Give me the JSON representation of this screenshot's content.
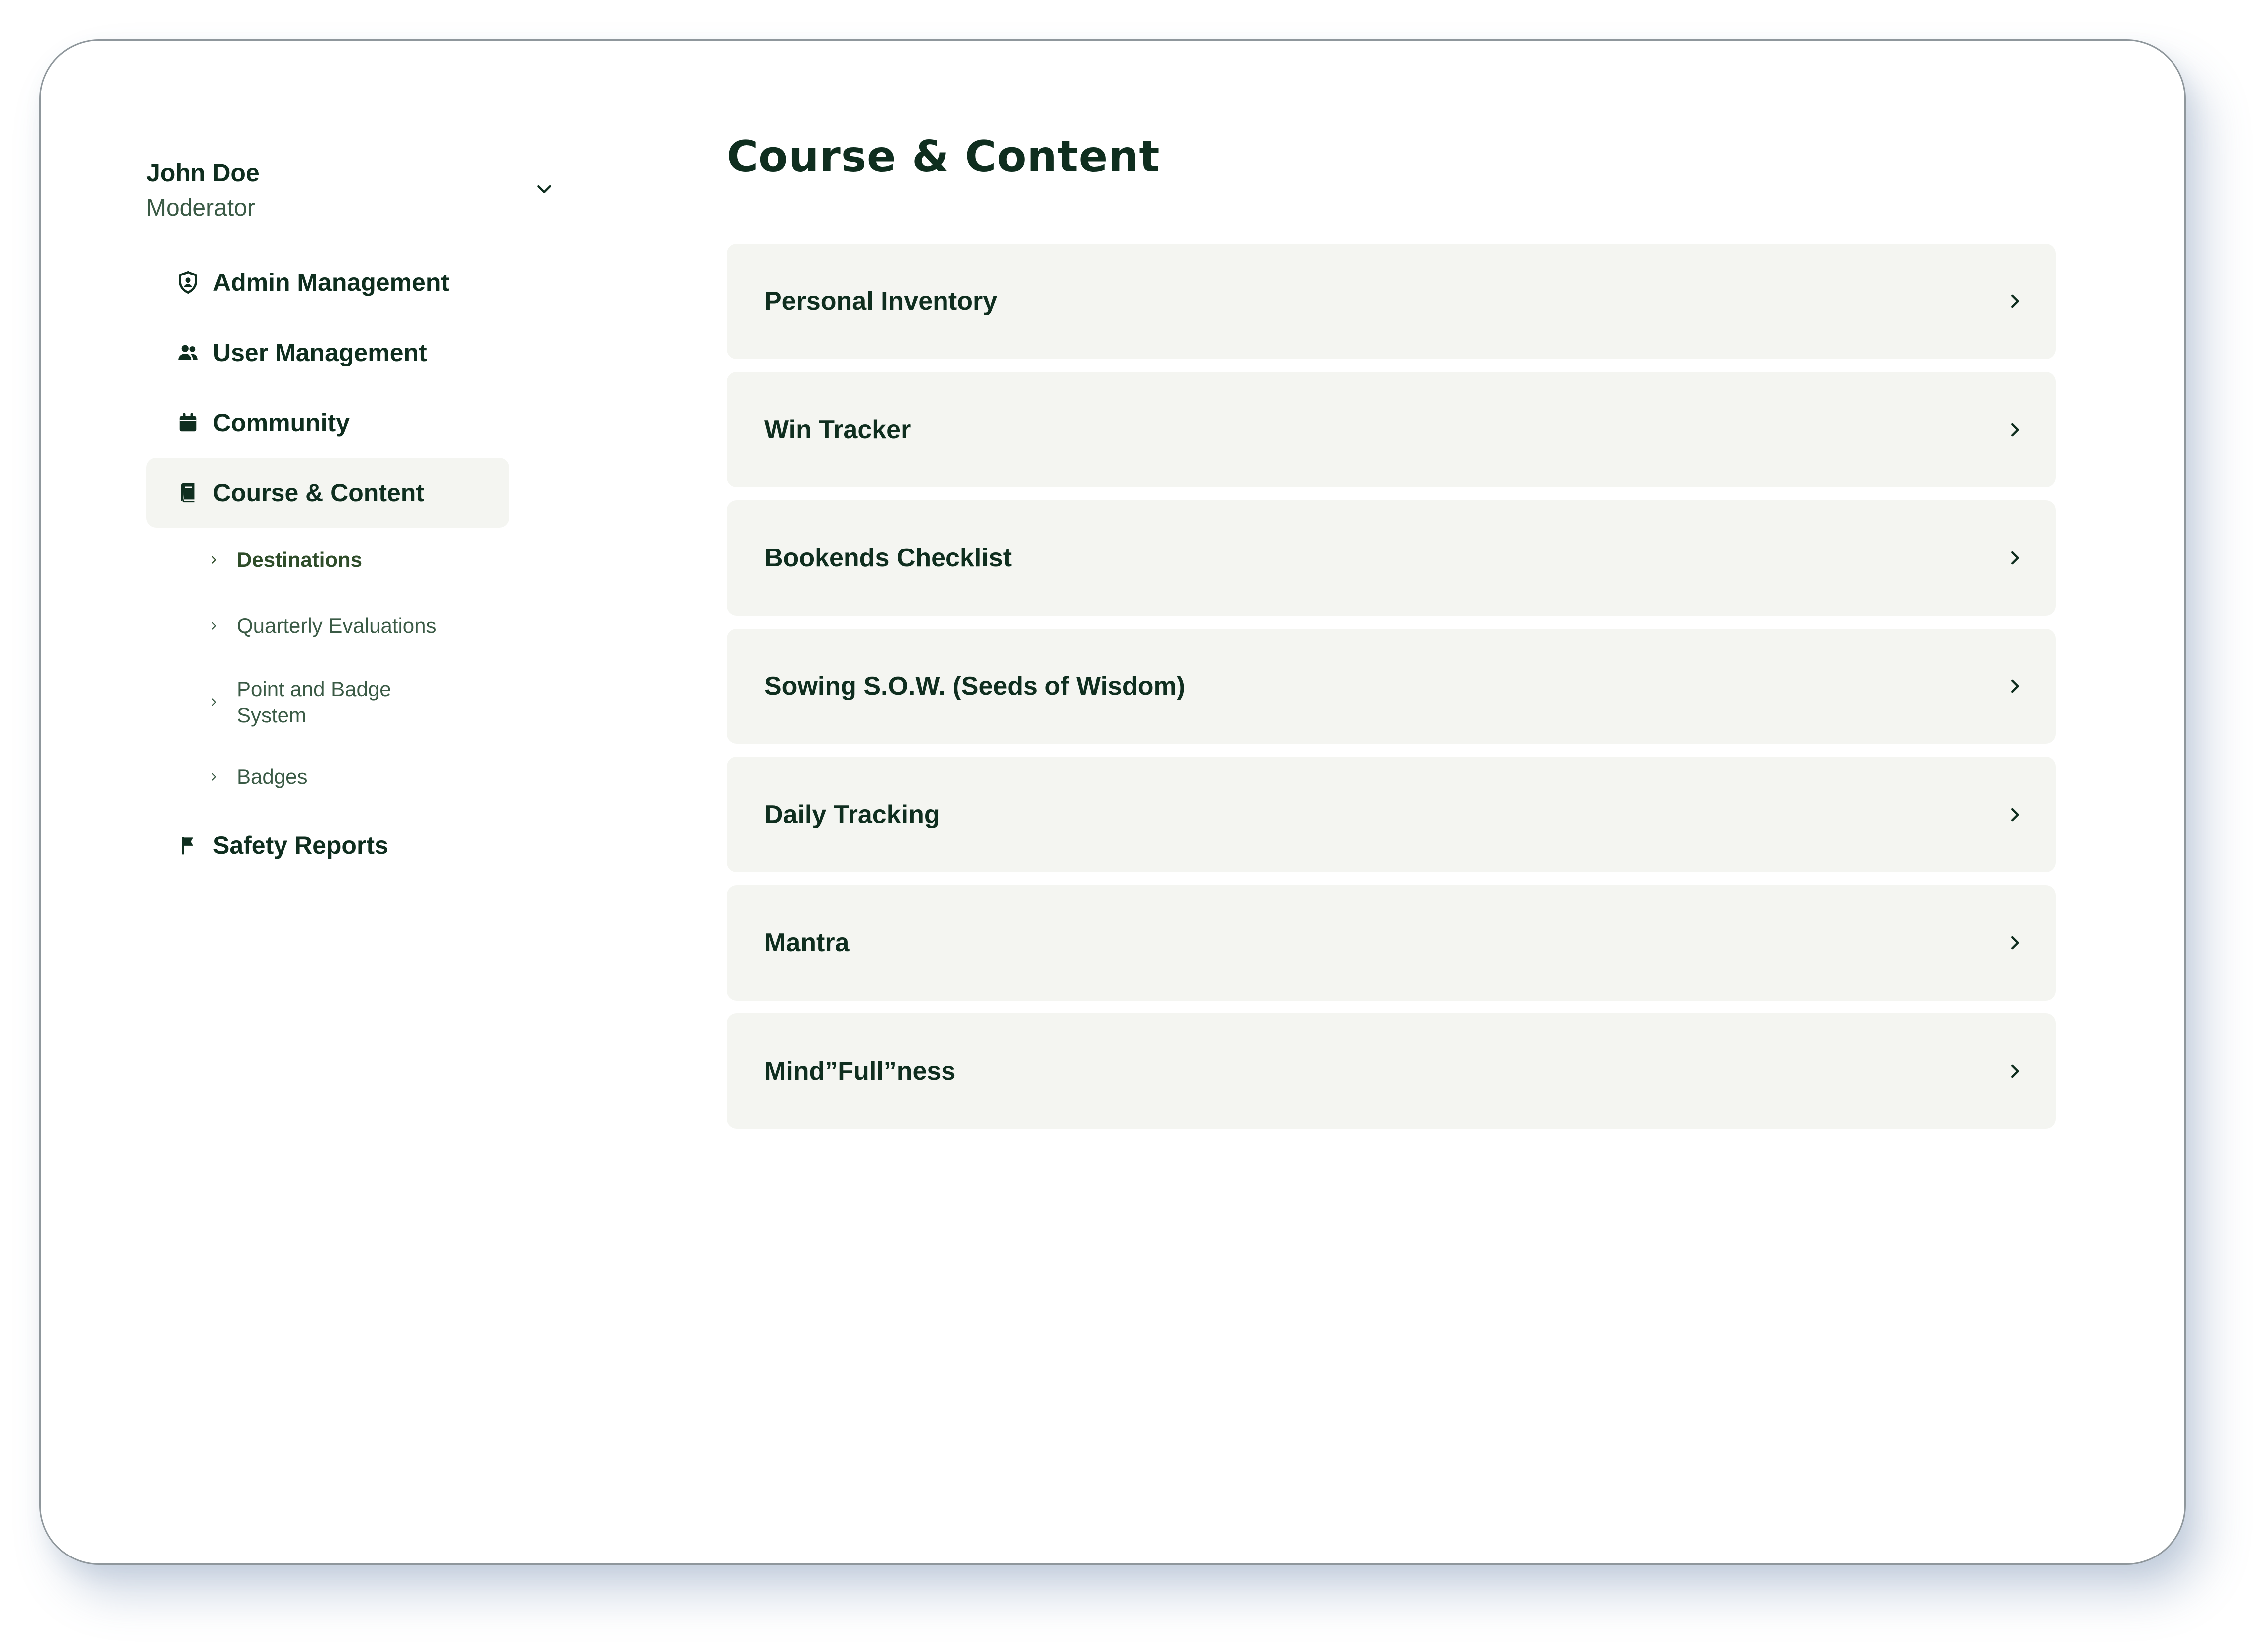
{
  "user": {
    "name": "John Doe",
    "role": "Moderator"
  },
  "sidebar": {
    "items": [
      {
        "label": "Admin Management",
        "icon": "shield-user-icon"
      },
      {
        "label": "User Management",
        "icon": "users-icon"
      },
      {
        "label": "Community",
        "icon": "calendar-icon"
      },
      {
        "label": "Course & Content",
        "icon": "book-icon",
        "active": true
      },
      {
        "label": "Safety Reports",
        "icon": "flag-icon"
      }
    ],
    "course_subitems": [
      {
        "label": "Destinations",
        "active": true
      },
      {
        "label": "Quarterly Evaluations"
      },
      {
        "label": "Point and Badge System"
      },
      {
        "label": "Badges"
      }
    ]
  },
  "main": {
    "title": "Course & Content",
    "cards": [
      {
        "label": "Personal Inventory"
      },
      {
        "label": "Win Tracker"
      },
      {
        "label": "Bookends Checklist"
      },
      {
        "label": "Sowing S.O.W. (Seeds of Wisdom)"
      },
      {
        "label": "Daily Tracking"
      },
      {
        "label": "Mantra"
      },
      {
        "label": "Mind”Full”ness"
      }
    ]
  },
  "colors": {
    "text_primary": "#0f2e1f",
    "text_secondary": "#3a5a45",
    "card_background": "#f4f5f1",
    "active_background": "#f4f5f1"
  }
}
